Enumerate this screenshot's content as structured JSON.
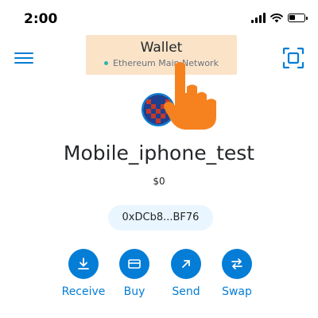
{
  "status_bar": {
    "time": "2:00"
  },
  "header": {
    "title": "Wallet",
    "network": "Ethereum Main Network",
    "menu_icon": "hamburger-menu-icon",
    "scan_icon": "qr-scan-icon"
  },
  "account": {
    "name": "Mobile_iphone_test",
    "balance": "$0",
    "address": "0xDCb8...BF76"
  },
  "actions": [
    {
      "label": "Receive",
      "icon": "receive-icon"
    },
    {
      "label": "Buy",
      "icon": "card-icon"
    },
    {
      "label": "Send",
      "icon": "send-arrow-icon"
    },
    {
      "label": "Swap",
      "icon": "swap-icon"
    }
  ],
  "colors": {
    "accent": "#037dd6",
    "highlight": "#fbe3c8",
    "address_bg": "#eaf6ff",
    "tap_hand": "#f5821f"
  }
}
